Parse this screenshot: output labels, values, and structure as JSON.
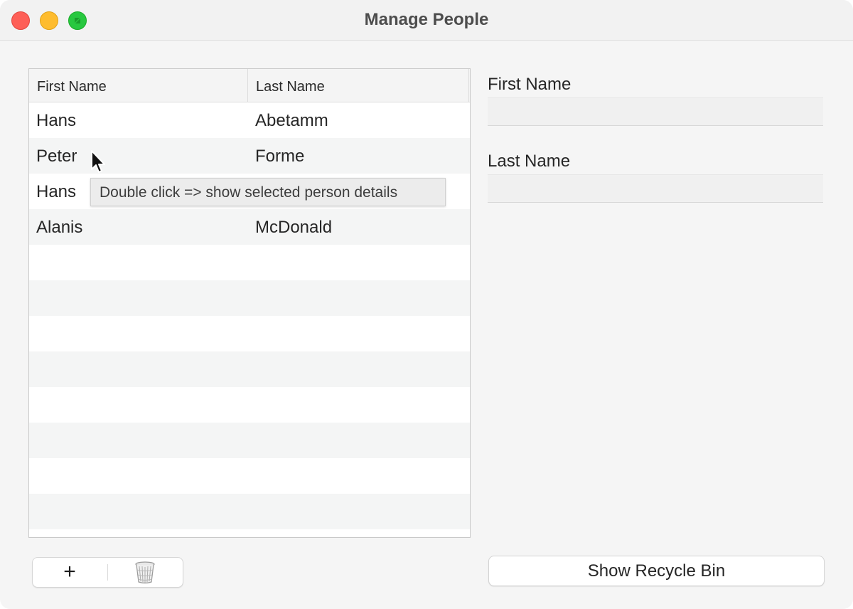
{
  "window": {
    "title": "Manage People"
  },
  "table": {
    "columns": [
      "First Name",
      "Last Name"
    ],
    "rows": [
      {
        "first": "Hans",
        "last": "Abetamm"
      },
      {
        "first": "Peter",
        "last": "Forme"
      },
      {
        "first": "Hans",
        "last": ""
      },
      {
        "first": "Alanis",
        "last": "McDonald"
      }
    ]
  },
  "tooltip": "Double click => show selected person details",
  "details": {
    "first_name_label": "First Name",
    "first_name_value": "",
    "last_name_label": "Last Name",
    "last_name_value": ""
  },
  "toolbar": {
    "add_label": "+",
    "delete_icon": "trash-icon"
  },
  "recycle_bin_button": "Show Recycle Bin"
}
